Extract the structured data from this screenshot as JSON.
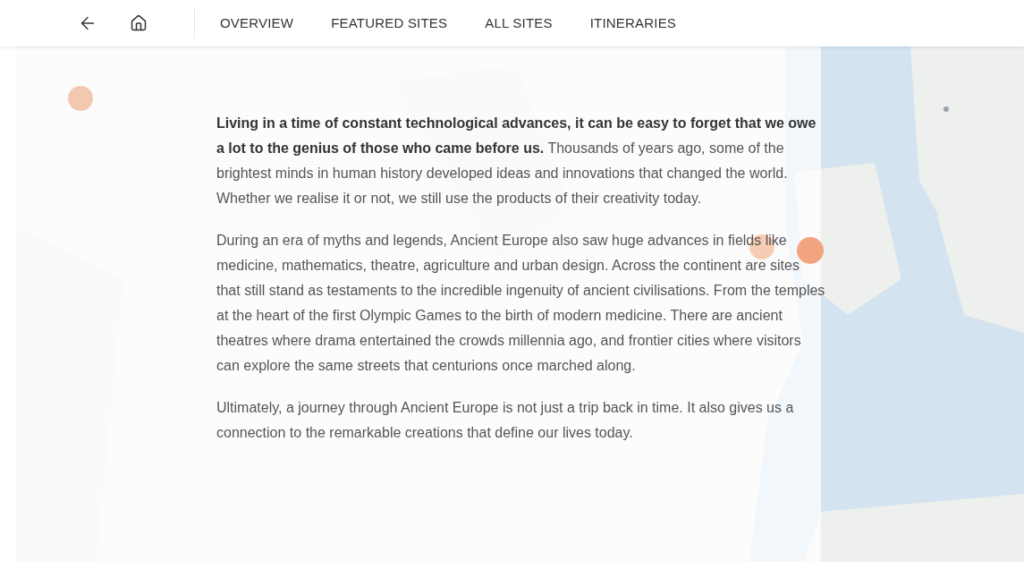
{
  "nav": {
    "tabs": [
      "OVERVIEW",
      "FEATURED SITES",
      "ALL SITES",
      "ITINERARIES"
    ]
  },
  "article": {
    "paragraphs": [
      "**Living in a time of constant technological advances, it can be easy to forget that we owe a lot to the genius of those who came before us.** Thousands of years ago, some of the brightest minds in human history developed ideas and innovations that changed the world. Whether we realise it or not, we still use the products of their creativity today.",
      "During an era of myths and legends, Ancient Europe also saw huge advances in fields like medicine, mathematics, theatre, agriculture and urban design. Across the continent are sites that still stand as testaments to the incredible ingenuity of ancient civilisations. From the temples at the heart of the first Olympic Games to the birth of modern medicine. There are ancient theatres where drama entertained the crowds millennia ago, and frontier cities where visitors can explore the same streets that centurions once marched along.",
      "Ultimately, a journey through Ancient Europe is not just a trip back in time. It also gives us a connection to the remarkable creations that define our lives today."
    ]
  }
}
